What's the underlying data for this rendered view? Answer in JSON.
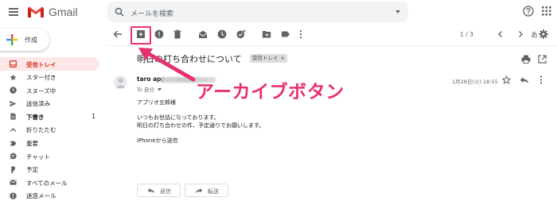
{
  "app": {
    "logo_text": "Gmail"
  },
  "search": {
    "placeholder": "メールを検索"
  },
  "compose": {
    "label": "作成"
  },
  "sidebar": {
    "items": [
      {
        "label": "受信トレイ",
        "icon": "inbox-icon",
        "active": true,
        "count": ""
      },
      {
        "label": "スター付き",
        "icon": "star-icon",
        "count": ""
      },
      {
        "label": "スヌーズ中",
        "icon": "clock-icon",
        "count": ""
      },
      {
        "label": "送信済み",
        "icon": "send-icon",
        "count": ""
      },
      {
        "label": "下書き",
        "icon": "draft-icon",
        "bold": true,
        "count": "1"
      },
      {
        "label": "折りたたむ",
        "icon": "chevron-up-icon",
        "count": ""
      },
      {
        "label": "重要",
        "icon": "important-icon",
        "count": ""
      },
      {
        "label": "チャット",
        "icon": "chat-icon",
        "count": ""
      },
      {
        "label": "予定",
        "icon": "calendar-icon",
        "count": ""
      },
      {
        "label": "すべてのメール",
        "icon": "all-mail-icon",
        "count": ""
      },
      {
        "label": "迷惑メール",
        "icon": "spam-icon",
        "count": ""
      }
    ]
  },
  "toolbar": {
    "pager": "1 / 3",
    "lang": "あ"
  },
  "email": {
    "subject": "明日の打ち合わせについて",
    "label_chip": "受信トレイ",
    "label_chip_close": "×",
    "sender_name": "taro app",
    "to_line": "To 自分",
    "date": "1月28日(火) 18:55",
    "body": [
      "アプリオ五郎様",
      "いつもお世話になっております。",
      "明日の打ち合わせの件、予定通りでお願いします。",
      "iPhoneから送信"
    ],
    "reply_label": "返信",
    "forward_label": "転送"
  },
  "annotation": {
    "text": "アーカイブボタン",
    "color": "#e8316b"
  },
  "colors": {
    "accent_red": "#d93025",
    "active_bg": "#fce8e6",
    "icon_gray": "#5f6368",
    "annotation_pink": "#e8316b"
  }
}
